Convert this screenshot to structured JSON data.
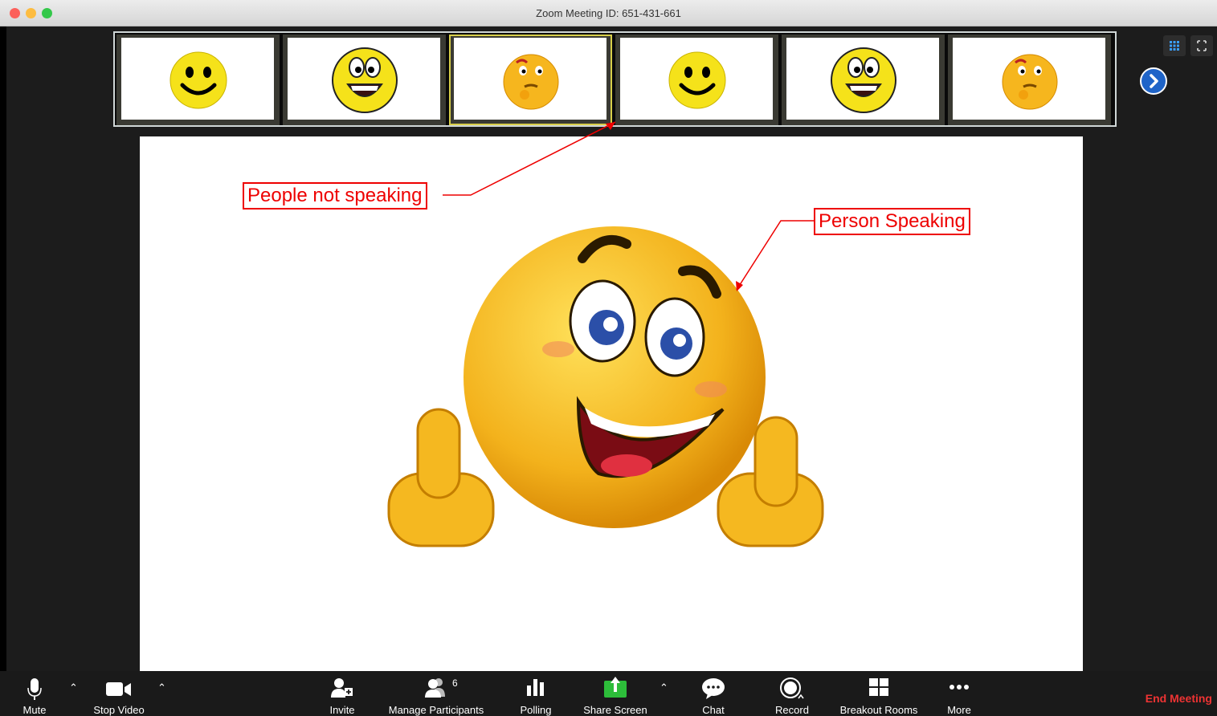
{
  "window": {
    "title": "Zoom Meeting ID: 651-431-661"
  },
  "annotations": {
    "not_speaking": "People not speaking",
    "speaking": "Person Speaking"
  },
  "toolbar": {
    "mute": "Mute",
    "stop_video": "Stop Video",
    "invite": "Invite",
    "manage_participants": "Manage Participants",
    "participant_count": "6",
    "polling": "Polling",
    "share_screen": "Share Screen",
    "chat": "Chat",
    "record": "Record",
    "breakout_rooms": "Breakout Rooms",
    "more": "More",
    "end_meeting": "End Meeting"
  },
  "colors": {
    "accent_blue": "#1f64c8",
    "share_green": "#2dbd3a",
    "end_red": "#e33333",
    "callout_red": "#e00000"
  },
  "icons": [
    "microphone-icon",
    "video-camera-icon",
    "add-user-icon",
    "participants-icon",
    "polling-icon",
    "share-screen-icon",
    "chat-icon",
    "record-icon",
    "breakout-rooms-icon",
    "more-icon",
    "grid-view-icon",
    "fullscreen-icon",
    "next-arrow-icon"
  ]
}
